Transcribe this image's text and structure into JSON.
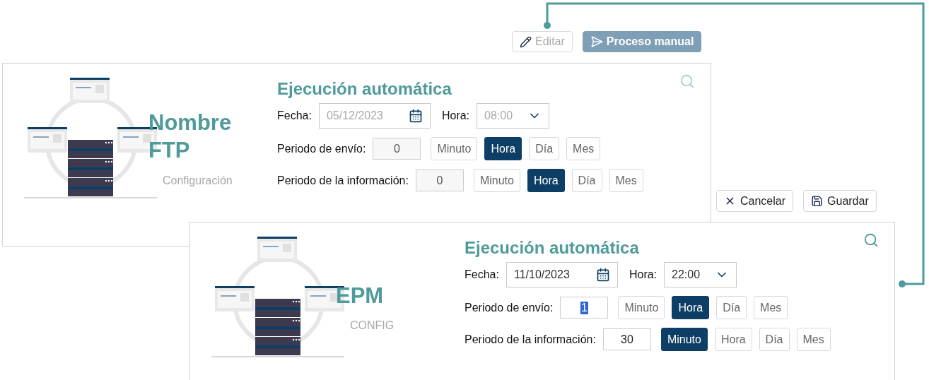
{
  "toolbar": {
    "buttons": [
      {
        "label": "Editar",
        "kind": "outline",
        "disabled": true
      },
      {
        "label": "Proceso manual",
        "kind": "filled",
        "disabled": false
      }
    ]
  },
  "actions": [
    {
      "label": "Cancelar"
    },
    {
      "label": "Guardar"
    }
  ],
  "cards": [
    {
      "name": "Nombre FTP",
      "subtitle": "Configuración",
      "disabled": true,
      "title": "Ejecución automática",
      "date": {
        "label": "Fecha:",
        "value": "05/12/2023"
      },
      "time": {
        "label": "Hora:",
        "value": "08:00"
      },
      "periods": [
        {
          "label": "Periodo de envío:",
          "value": "0",
          "text_selected": false,
          "options": [
            {
              "label": "Minuto",
              "selected": false
            },
            {
              "label": "Hora",
              "selected": true
            },
            {
              "label": "Día",
              "selected": false
            },
            {
              "label": "Mes",
              "selected": false
            }
          ]
        },
        {
          "label": "Periodo de la información:",
          "value": "0",
          "text_selected": false,
          "options": [
            {
              "label": "Minuto",
              "selected": false
            },
            {
              "label": "Hora",
              "selected": true
            },
            {
              "label": "Día",
              "selected": false
            },
            {
              "label": "Mes",
              "selected": false
            }
          ]
        }
      ]
    },
    {
      "name": "EPM",
      "subtitle": "CONFIG",
      "disabled": false,
      "title": "Ejecución automática",
      "date": {
        "label": "Fecha:",
        "value": "11/10/2023"
      },
      "time": {
        "label": "Hora:",
        "value": "22:00"
      },
      "periods": [
        {
          "label": "Periodo de envío:",
          "value": "1",
          "text_selected": true,
          "options": [
            {
              "label": "Minuto",
              "selected": false
            },
            {
              "label": "Hora",
              "selected": true
            },
            {
              "label": "Día",
              "selected": false
            },
            {
              "label": "Mes",
              "selected": false
            }
          ]
        },
        {
          "label": "Periodo de la información:",
          "value": "30",
          "text_selected": false,
          "options": [
            {
              "label": "Minuto",
              "selected": true
            },
            {
              "label": "Hora",
              "selected": false
            },
            {
              "label": "Día",
              "selected": false
            },
            {
              "label": "Mes",
              "selected": false
            }
          ]
        }
      ]
    }
  ]
}
